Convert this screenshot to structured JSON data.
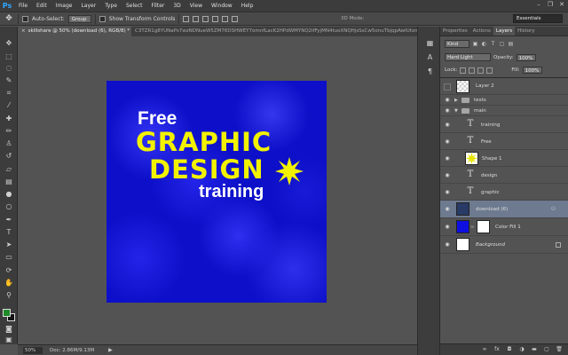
{
  "app": {
    "logo": "Ps"
  },
  "menu": [
    "File",
    "Edit",
    "Image",
    "Layer",
    "Type",
    "Select",
    "Filter",
    "3D",
    "View",
    "Window",
    "Help"
  ],
  "window_controls": {
    "minimize": "–",
    "restore": "❐",
    "close": "✕"
  },
  "options": {
    "auto_select_label": "Auto-Select:",
    "auto_select_value": "Group",
    "transform_label": "Show Transform Controls",
    "mode3d_label": "3D Mode:",
    "workspace": "Essentials"
  },
  "tabs": [
    {
      "label": "skillshare @ 50% (download (6), RGB/8) *",
      "close": "×"
    },
    {
      "label": "C3TZR1g8YUNaPs7wzNDNueW5ZM76DSHWEY7omnfLacK2HPdWMYNQ2ifFyjMN4tuoXNQHjsSsCw5onuTbjqpAwIUtxm6"
    }
  ],
  "artwork": {
    "line1": "Free",
    "line2": "GRAPHIC",
    "line3": "DESIGN",
    "line4": "training",
    "bg_color": "#0d10c8",
    "accent_color": "#f2f200"
  },
  "status": {
    "zoom": "50%",
    "doc": "Doc: 2.86M/9.13M"
  },
  "panel": {
    "tabs": [
      "Properties",
      "Actions",
      "Layers",
      "History"
    ],
    "active_tab": "Layers",
    "kind": "Kind",
    "blend_mode": "Hard Light",
    "opacity_label": "Opacity:",
    "opacity": "100%",
    "lock_label": "Lock:",
    "fill_label": "Fill:",
    "fill": "100%"
  },
  "layers": [
    {
      "name": "Layer 2",
      "kind": "pixel",
      "visible": false
    },
    {
      "name": "texts",
      "kind": "group",
      "visible": true
    },
    {
      "name": "main",
      "kind": "group-open",
      "visible": true
    },
    {
      "name": "training",
      "kind": "text",
      "visible": true
    },
    {
      "name": "Free",
      "kind": "text",
      "visible": true
    },
    {
      "name": "Shape 1",
      "kind": "shape",
      "visible": true
    },
    {
      "name": "design",
      "kind": "text",
      "visible": true
    },
    {
      "name": "graphic",
      "kind": "text",
      "visible": true
    },
    {
      "name": "download (6)",
      "kind": "image",
      "visible": true,
      "selected": true
    },
    {
      "name": "Color Fill 1",
      "kind": "fill",
      "visible": true
    },
    {
      "name": "Background",
      "kind": "background",
      "visible": true,
      "locked": true
    }
  ],
  "panel_footer": [
    "link-icon",
    "fx-icon",
    "mask-icon",
    "adjustment-icon",
    "folder-icon",
    "new-layer-icon",
    "trash-icon"
  ]
}
